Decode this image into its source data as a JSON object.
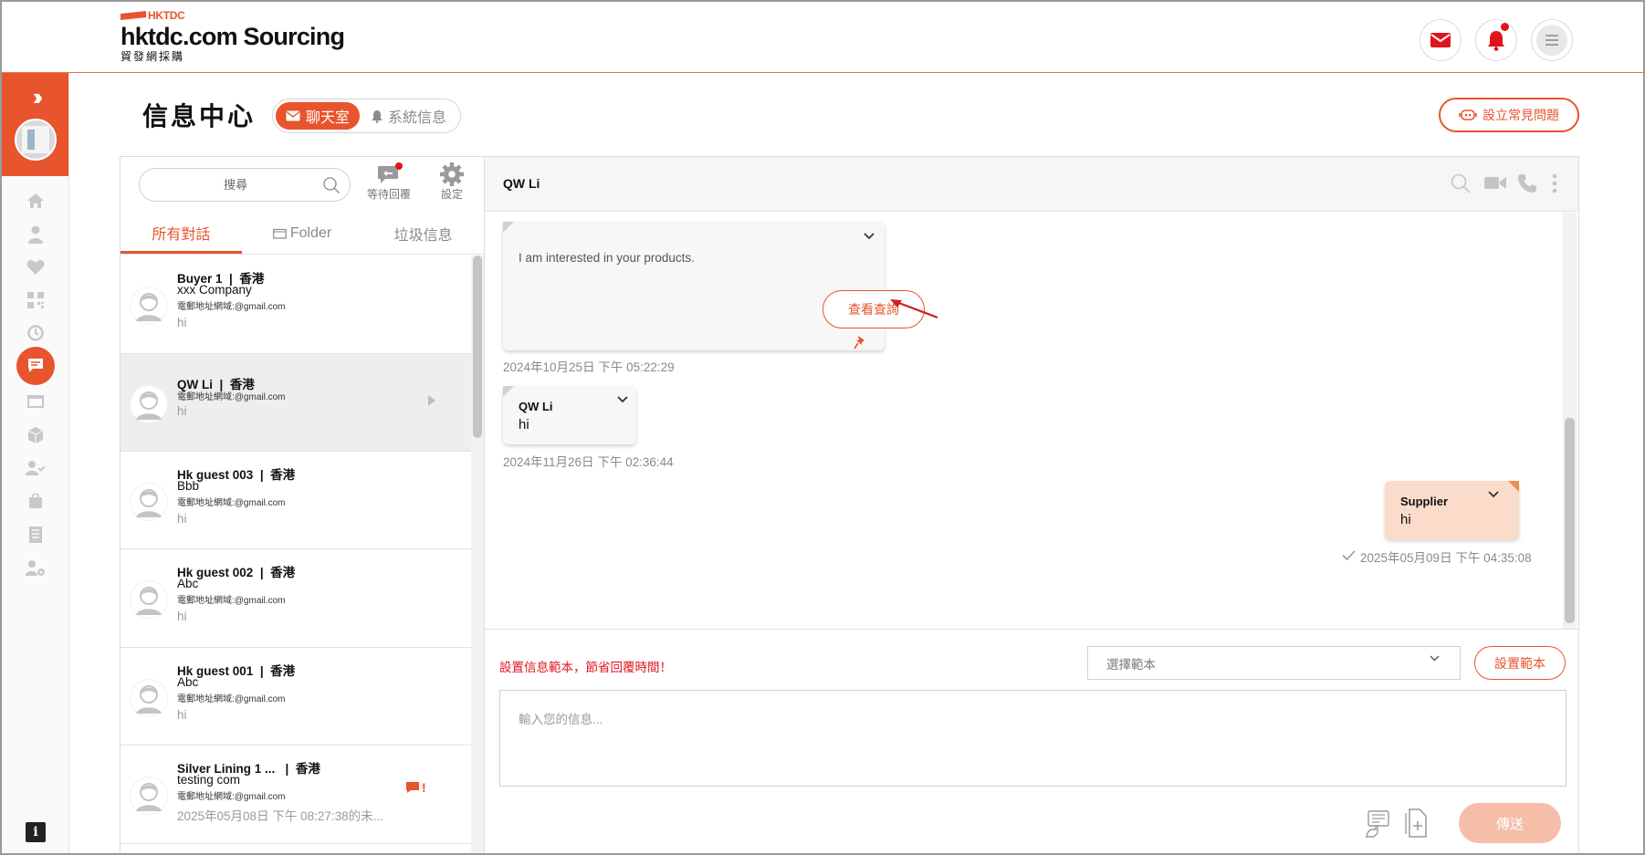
{
  "header": {
    "brand_small": "HKTDC",
    "brand_name": "hktdc.com Sourcing",
    "brand_sub": "貿發網採購"
  },
  "page": {
    "title": "信息中心",
    "tab_chat": "聊天室",
    "tab_system": "系統信息",
    "faq_button": "設立常見問題"
  },
  "sidebar": {
    "icons": [
      "home-icon",
      "user-icon",
      "heart-icon",
      "qr-code-icon",
      "history-icon",
      "chat-icon",
      "browser-icon",
      "package-icon",
      "user-check-icon",
      "shopping-bag-icon",
      "list-icon",
      "user-settings-icon"
    ],
    "active": "chat-icon",
    "info": "i"
  },
  "conversation_panel": {
    "search_placeholder": "搜尋",
    "pending_label": "等待回覆",
    "settings_label": "設定",
    "tabs": [
      "所有對話",
      "Folder",
      "垃圾信息"
    ],
    "active_tab": "所有對話",
    "conversations": [
      {
        "name": "Buyer 1",
        "region": "香港",
        "company": "xxx Company",
        "email": "電郵地址網域:@gmail.com",
        "message": "hi"
      },
      {
        "name": "QW Li",
        "region": "香港",
        "company": "",
        "email": "電郵地址網域:@gmail.com",
        "message": "hi"
      },
      {
        "name": "Hk guest 003",
        "region": "香港",
        "company": "Bbb",
        "email": "電郵地址網域:@gmail.com",
        "message": "hi"
      },
      {
        "name": "Hk guest 002",
        "region": "香港",
        "company": "Abc",
        "email": "電郵地址網域:@gmail.com",
        "message": "hi"
      },
      {
        "name": "Hk guest 001",
        "region": "香港",
        "company": "Abc",
        "email": "電郵地址網域:@gmail.com",
        "message": "hi"
      },
      {
        "name": "Silver Lining 1 ...",
        "region": "香港",
        "company": "testing com",
        "email": "電郵地址網域:@gmail.com",
        "message": "2025年05月08日 下午 08:27:38的未..."
      }
    ],
    "separator": "|",
    "flag_mark": "!"
  },
  "chat": {
    "title": "QW Li",
    "messages": [
      {
        "type": "inquiry",
        "text": "I am interested in your products.",
        "button": "查看查詢",
        "timestamp": "2024年10月25日 下午 05:22:29"
      },
      {
        "type": "received",
        "sender": "QW Li",
        "text": "hi",
        "timestamp": "2024年11月26日 下午 02:36:44"
      },
      {
        "type": "sent",
        "sender": "Supplier",
        "text": "hi",
        "timestamp": "2025年05月09日 下午 04:35:08"
      }
    ],
    "composer": {
      "template_hint": "設置信息範本，節省回覆時間！",
      "template_select": "選擇範本",
      "template_button": "設置範本",
      "input_placeholder": "輸入您的信息...",
      "send_label": "傳送"
    }
  },
  "colors": {
    "accent": "#e8542d",
    "alert": "#e0131d",
    "sent_bubble": "#fbdcca",
    "send_disabled": "#f6bda9"
  }
}
